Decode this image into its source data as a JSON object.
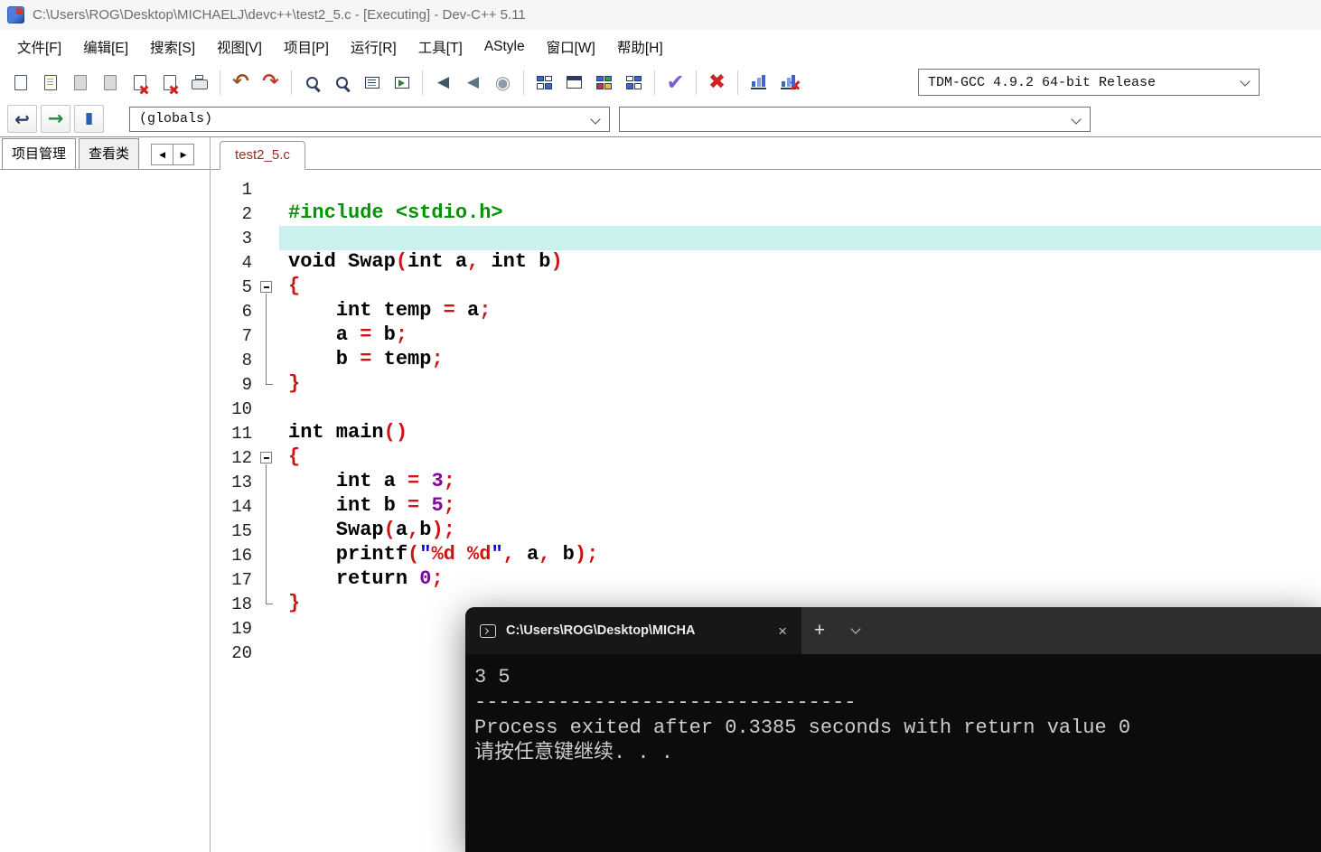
{
  "window": {
    "title": "C:\\Users\\ROG\\Desktop\\MICHAELJ\\devc++\\test2_5.c - [Executing] - Dev-C++ 5.11"
  },
  "menu": {
    "items": [
      "文件[F]",
      "编辑[E]",
      "搜索[S]",
      "视图[V]",
      "项目[P]",
      "运行[R]",
      "工具[T]",
      "AStyle",
      "窗口[W]",
      "帮助[H]"
    ]
  },
  "toolbar_main": {
    "compiler": "TDM-GCC 4.9.2 64-bit Release",
    "buttons": [
      {
        "name": "new-source-button",
        "icon": "page"
      },
      {
        "name": "open-button",
        "icon": "page-open"
      },
      {
        "name": "save-button",
        "icon": "page-gray"
      },
      {
        "name": "save-all-button",
        "icon": "page-gray"
      },
      {
        "name": "close-button",
        "icon": "page-x"
      },
      {
        "name": "close-all-button",
        "icon": "page-x"
      },
      {
        "name": "print-button",
        "icon": "printer"
      },
      {
        "sep": true
      },
      {
        "name": "undo-button",
        "icon": "glyph",
        "glyph": "↶",
        "color": "#9a4f1e",
        "size": 22
      },
      {
        "name": "redo-button",
        "icon": "glyph",
        "glyph": "↷",
        "color": "#c03a2b",
        "size": 22
      },
      {
        "sep": true
      },
      {
        "name": "find-button",
        "icon": "mag"
      },
      {
        "name": "replace-button",
        "icon": "mag"
      },
      {
        "name": "goto-line-button",
        "icon": "winlines"
      },
      {
        "name": "goto-function-button",
        "icon": "winarrow"
      },
      {
        "sep": true
      },
      {
        "name": "back-button",
        "icon": "glyph",
        "glyph": "◀",
        "color": "#3d5866",
        "size": 17
      },
      {
        "name": "forward-button",
        "icon": "glyph",
        "glyph": "◀",
        "color": "#5a7482",
        "size": 17
      },
      {
        "name": "pause-button",
        "icon": "glyph",
        "glyph": "◉",
        "color": "#8e9aa6",
        "size": 20
      },
      {
        "sep": true
      },
      {
        "name": "compile-button",
        "icon": "grid",
        "c": [
          "#3f63c9",
          "#ffffff",
          "#ffffff",
          "#3f63c9"
        ]
      },
      {
        "name": "run-button",
        "icon": "grid1"
      },
      {
        "name": "compile-run-button",
        "icon": "grid",
        "c": [
          "#3f63c9",
          "#2f9e44",
          "#d7263d",
          "#f4c20d"
        ]
      },
      {
        "name": "rebuild-button",
        "icon": "grid",
        "c": [
          "#ffffff",
          "#3f63c9",
          "#3f63c9",
          "#ffffff"
        ]
      },
      {
        "sep": true
      },
      {
        "name": "syntax-check-button",
        "icon": "glyph",
        "glyph": "✔",
        "color": "#7d5bd4",
        "size": 24
      },
      {
        "sep": true
      },
      {
        "name": "abort-button",
        "icon": "glyph",
        "glyph": "✖",
        "color": "#d42020",
        "size": 23
      },
      {
        "sep": true
      },
      {
        "name": "profile-button",
        "icon": "chart"
      },
      {
        "name": "profile-clear-button",
        "icon": "chart-x"
      }
    ]
  },
  "toolbar_class": {
    "globals": "(globals)",
    "members": "",
    "buttons": [
      {
        "name": "back-jump-button",
        "icon": "glyph",
        "glyph": "↩",
        "color": "#2f3e66",
        "size": 20
      },
      {
        "name": "goto-declaration-button",
        "icon": "glyph",
        "glyph": "→",
        "color": "#1d8a3e",
        "size": 21
      },
      {
        "name": "watch-button",
        "icon": "glyph",
        "glyph": "▮",
        "color": "#2d5bb8",
        "size": 17
      }
    ]
  },
  "left_panel": {
    "tabs": [
      "项目管理",
      "查看类"
    ],
    "scroll_left": "◀",
    "scroll_right": "▶"
  },
  "editor": {
    "tab": "test2_5.c",
    "lines": [
      {},
      {
        "t": [
          {
            "t": "d",
            "x": "#include <stdio.h>"
          }
        ]
      },
      {
        "hl": true
      },
      {
        "t": [
          {
            "t": "k",
            "x": "void"
          },
          {
            "t": "i",
            "x": " Swap"
          },
          {
            "t": "s",
            "x": "("
          },
          {
            "t": "k",
            "x": "int"
          },
          {
            "t": "i",
            "x": " a"
          },
          {
            "t": "s",
            "x": ","
          },
          {
            "t": "i",
            "x": " "
          },
          {
            "t": "k",
            "x": "int"
          },
          {
            "t": "i",
            "x": " b"
          },
          {
            "t": "s",
            "x": ")"
          }
        ]
      },
      {
        "fold": "start",
        "t": [
          {
            "t": "s",
            "x": "{"
          }
        ]
      },
      {
        "fold": "mid",
        "t": [
          {
            "t": "i",
            "x": "    "
          },
          {
            "t": "k",
            "x": "int"
          },
          {
            "t": "i",
            "x": " temp "
          },
          {
            "t": "s",
            "x": "="
          },
          {
            "t": "i",
            "x": " a"
          },
          {
            "t": "s",
            "x": ";"
          }
        ]
      },
      {
        "fold": "mid",
        "t": [
          {
            "t": "i",
            "x": "    a "
          },
          {
            "t": "s",
            "x": "="
          },
          {
            "t": "i",
            "x": " b"
          },
          {
            "t": "s",
            "x": ";"
          }
        ]
      },
      {
        "fold": "mid",
        "t": [
          {
            "t": "i",
            "x": "    b "
          },
          {
            "t": "s",
            "x": "="
          },
          {
            "t": "i",
            "x": " temp"
          },
          {
            "t": "s",
            "x": ";"
          }
        ]
      },
      {
        "fold": "end",
        "t": [
          {
            "t": "s",
            "x": "}"
          }
        ]
      },
      {},
      {
        "t": [
          {
            "t": "k",
            "x": "int"
          },
          {
            "t": "i",
            "x": " main"
          },
          {
            "t": "s",
            "x": "()"
          }
        ]
      },
      {
        "fold": "start",
        "t": [
          {
            "t": "s",
            "x": "{"
          }
        ]
      },
      {
        "fold": "mid",
        "t": [
          {
            "t": "i",
            "x": "    "
          },
          {
            "t": "k",
            "x": "int"
          },
          {
            "t": "i",
            "x": " a "
          },
          {
            "t": "s",
            "x": "="
          },
          {
            "t": "i",
            "x": " "
          },
          {
            "t": "n",
            "x": "3"
          },
          {
            "t": "s",
            "x": ";"
          }
        ]
      },
      {
        "fold": "mid",
        "t": [
          {
            "t": "i",
            "x": "    "
          },
          {
            "t": "k",
            "x": "int"
          },
          {
            "t": "i",
            "x": " b "
          },
          {
            "t": "s",
            "x": "="
          },
          {
            "t": "i",
            "x": " "
          },
          {
            "t": "n",
            "x": "5"
          },
          {
            "t": "s",
            "x": ";"
          }
        ]
      },
      {
        "fold": "mid",
        "t": [
          {
            "t": "i",
            "x": "    Swap"
          },
          {
            "t": "s",
            "x": "("
          },
          {
            "t": "i",
            "x": "a"
          },
          {
            "t": "s",
            "x": ","
          },
          {
            "t": "i",
            "x": "b"
          },
          {
            "t": "s",
            "x": ")"
          },
          {
            "t": "s",
            "x": ";"
          }
        ]
      },
      {
        "fold": "mid",
        "t": [
          {
            "t": "i",
            "x": "    printf"
          },
          {
            "t": "s",
            "x": "("
          },
          {
            "t": "r",
            "x": "\""
          },
          {
            "t": "f",
            "x": "%d"
          },
          {
            "t": "r",
            "x": " "
          },
          {
            "t": "f",
            "x": "%d"
          },
          {
            "t": "r",
            "x": "\""
          },
          {
            "t": "s",
            "x": ","
          },
          {
            "t": "i",
            "x": " a"
          },
          {
            "t": "s",
            "x": ","
          },
          {
            "t": "i",
            "x": " b"
          },
          {
            "t": "s",
            "x": ")"
          },
          {
            "t": "s",
            "x": ";"
          }
        ]
      },
      {
        "fold": "mid",
        "t": [
          {
            "t": "i",
            "x": "    "
          },
          {
            "t": "k",
            "x": "return"
          },
          {
            "t": "i",
            "x": " "
          },
          {
            "t": "n",
            "x": "0"
          },
          {
            "t": "s",
            "x": ";"
          }
        ]
      },
      {
        "fold": "end",
        "t": [
          {
            "t": "s",
            "x": "}"
          }
        ]
      },
      {},
      {}
    ]
  },
  "terminal": {
    "tab_title": "C:\\Users\\ROG\\Desktop\\MICHA",
    "close_glyph": "×",
    "new_tab_glyph": "+",
    "lines": [
      "3 5",
      "--------------------------------",
      "Process exited after 0.3385 seconds with return value 0",
      "请按任意键继续. . ."
    ]
  }
}
